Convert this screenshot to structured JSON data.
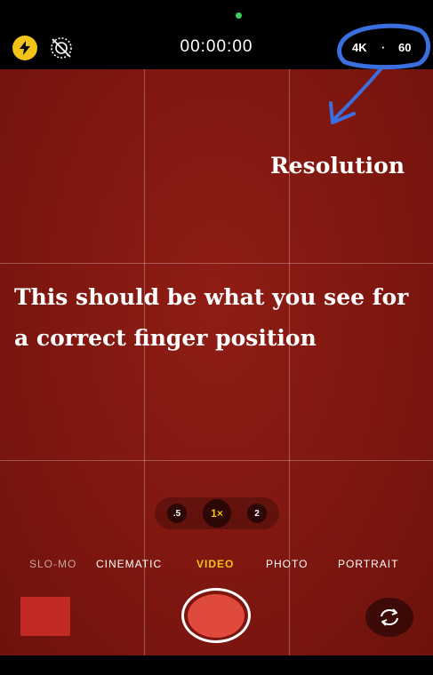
{
  "status": {
    "timer": "00:00:00",
    "resolution": "4K",
    "separator": "·",
    "frame_rate": "60"
  },
  "annotation": {
    "resolution_label": "Resolution",
    "caption_line1": "This should be what you see for",
    "caption_line2": "a correct finger position",
    "highlight_color": "#3b6fe0"
  },
  "zoom": {
    "options": [
      ".5",
      "1×",
      "2"
    ],
    "selected": "1×"
  },
  "modes": {
    "items": [
      "SLO-MO",
      "CINEMATIC",
      "VIDEO",
      "PHOTO",
      "PORTRAIT"
    ],
    "selected": "VIDEO"
  },
  "colors": {
    "accent": "#f2c318",
    "viewfinder": "#7f1710",
    "shutter_inner": "#e04a3c",
    "recording_dot": "#3bd15b"
  },
  "icons": {
    "flash": "flash-icon",
    "live_photo": "live-photo-off-icon",
    "flip_camera": "flip-camera-icon"
  }
}
